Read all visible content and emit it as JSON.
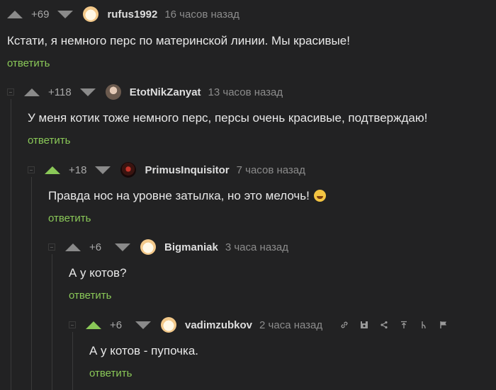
{
  "comments": [
    {
      "rating": "+69",
      "user": "rufus1992",
      "time": "16 часов назад",
      "text": "Кстати, я немного перс по материнской линии. Мы красивые!",
      "reply": "ответить"
    },
    {
      "rating": "+118",
      "user": "EtotNikZanyat",
      "time": "13 часов назад",
      "text": "У меня котик тоже немного перс, персы очень красивые, подтверждаю!",
      "reply": "ответить"
    },
    {
      "rating": "+18",
      "user": "PrimusInquisitor",
      "time": "7 часов назад",
      "text": "Правда нос на уровне затылка, но это мелочь!",
      "reply": "ответить"
    },
    {
      "rating": "+6",
      "user": "Bigmaniak",
      "time": "3 часа назад",
      "text": "А у котов?",
      "reply": "ответить"
    },
    {
      "rating": "+6",
      "user": "vadimzubkov",
      "time": "2 часа назад",
      "text": "А у котов - пупочка.",
      "reply": "ответить"
    }
  ],
  "colors": {
    "background": "#222223",
    "upvote_active": "#8ac858",
    "reply_link": "#8ac858"
  },
  "icons": [
    "link-icon",
    "save-icon",
    "share-icon",
    "goto-parent-icon",
    "branch-icon",
    "report-flag-icon"
  ]
}
